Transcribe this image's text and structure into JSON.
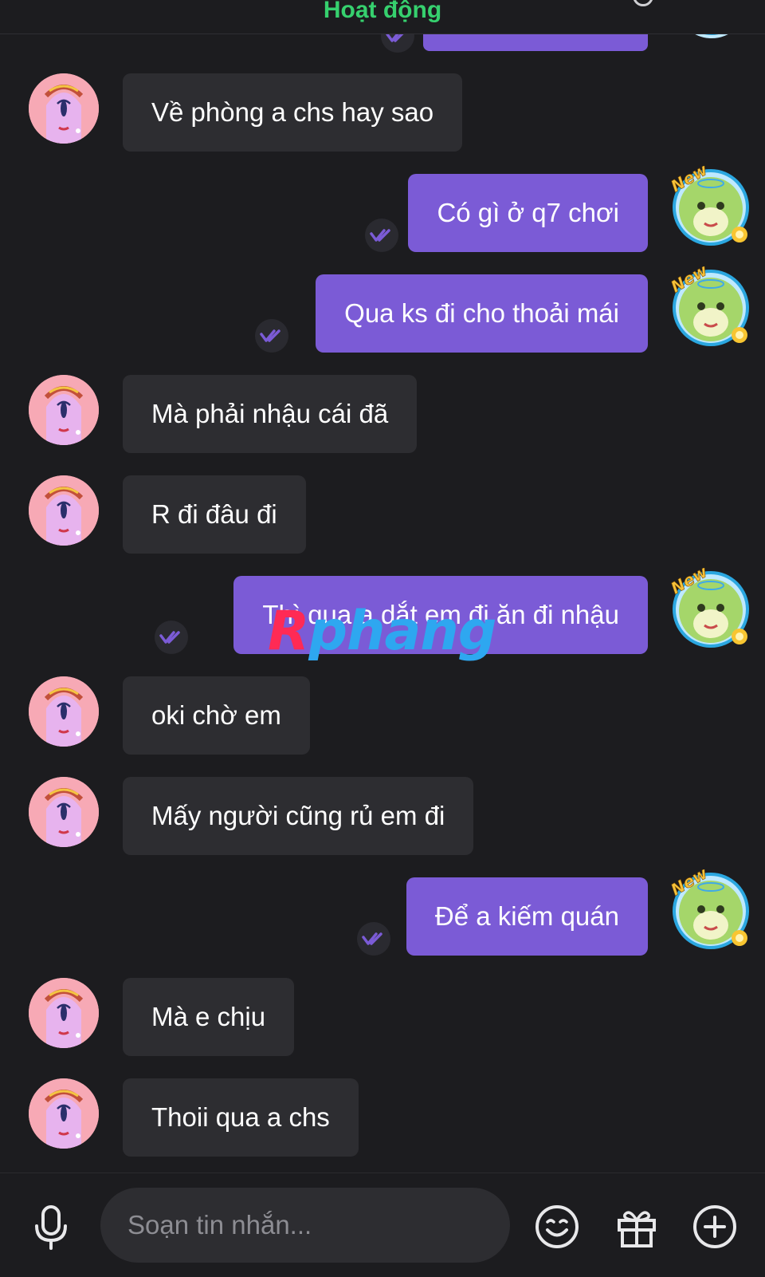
{
  "header": {
    "status": "Hoạt động"
  },
  "messages": [
    {
      "side": "in",
      "text": "Về phòng a chs hay sao"
    },
    {
      "side": "out",
      "text": "Có gì ở q7 chơi"
    },
    {
      "side": "out",
      "text": "Qua ks đi cho thoải mái"
    },
    {
      "side": "in",
      "text": "Mà phải nhậu cái đã"
    },
    {
      "side": "in",
      "text": "R đi đâu đi"
    },
    {
      "side": "out",
      "text": "Thì qua a dắt em đi ăn đi nhậu"
    },
    {
      "side": "in",
      "text": "oki chờ em"
    },
    {
      "side": "in",
      "text": "Mấy người cũng rủ em đi"
    },
    {
      "side": "out",
      "text": "Để a kiếm quán"
    },
    {
      "side": "in",
      "text": "Mà e chịu"
    },
    {
      "side": "in",
      "text": "Thoii qua a chs"
    }
  ],
  "composer": {
    "placeholder": "Soạn tin nhắn..."
  },
  "badge": {
    "label": "New"
  },
  "watermark": {
    "first": "R",
    "rest": "phang"
  },
  "colors": {
    "outgoing": "#7b5bd6",
    "incoming": "#2d2d31",
    "status": "#36d06e",
    "background": "#1c1c1f"
  },
  "icons": [
    "microphone-icon",
    "emoji-icon",
    "gift-icon",
    "add-icon",
    "read-receipt-icon"
  ]
}
